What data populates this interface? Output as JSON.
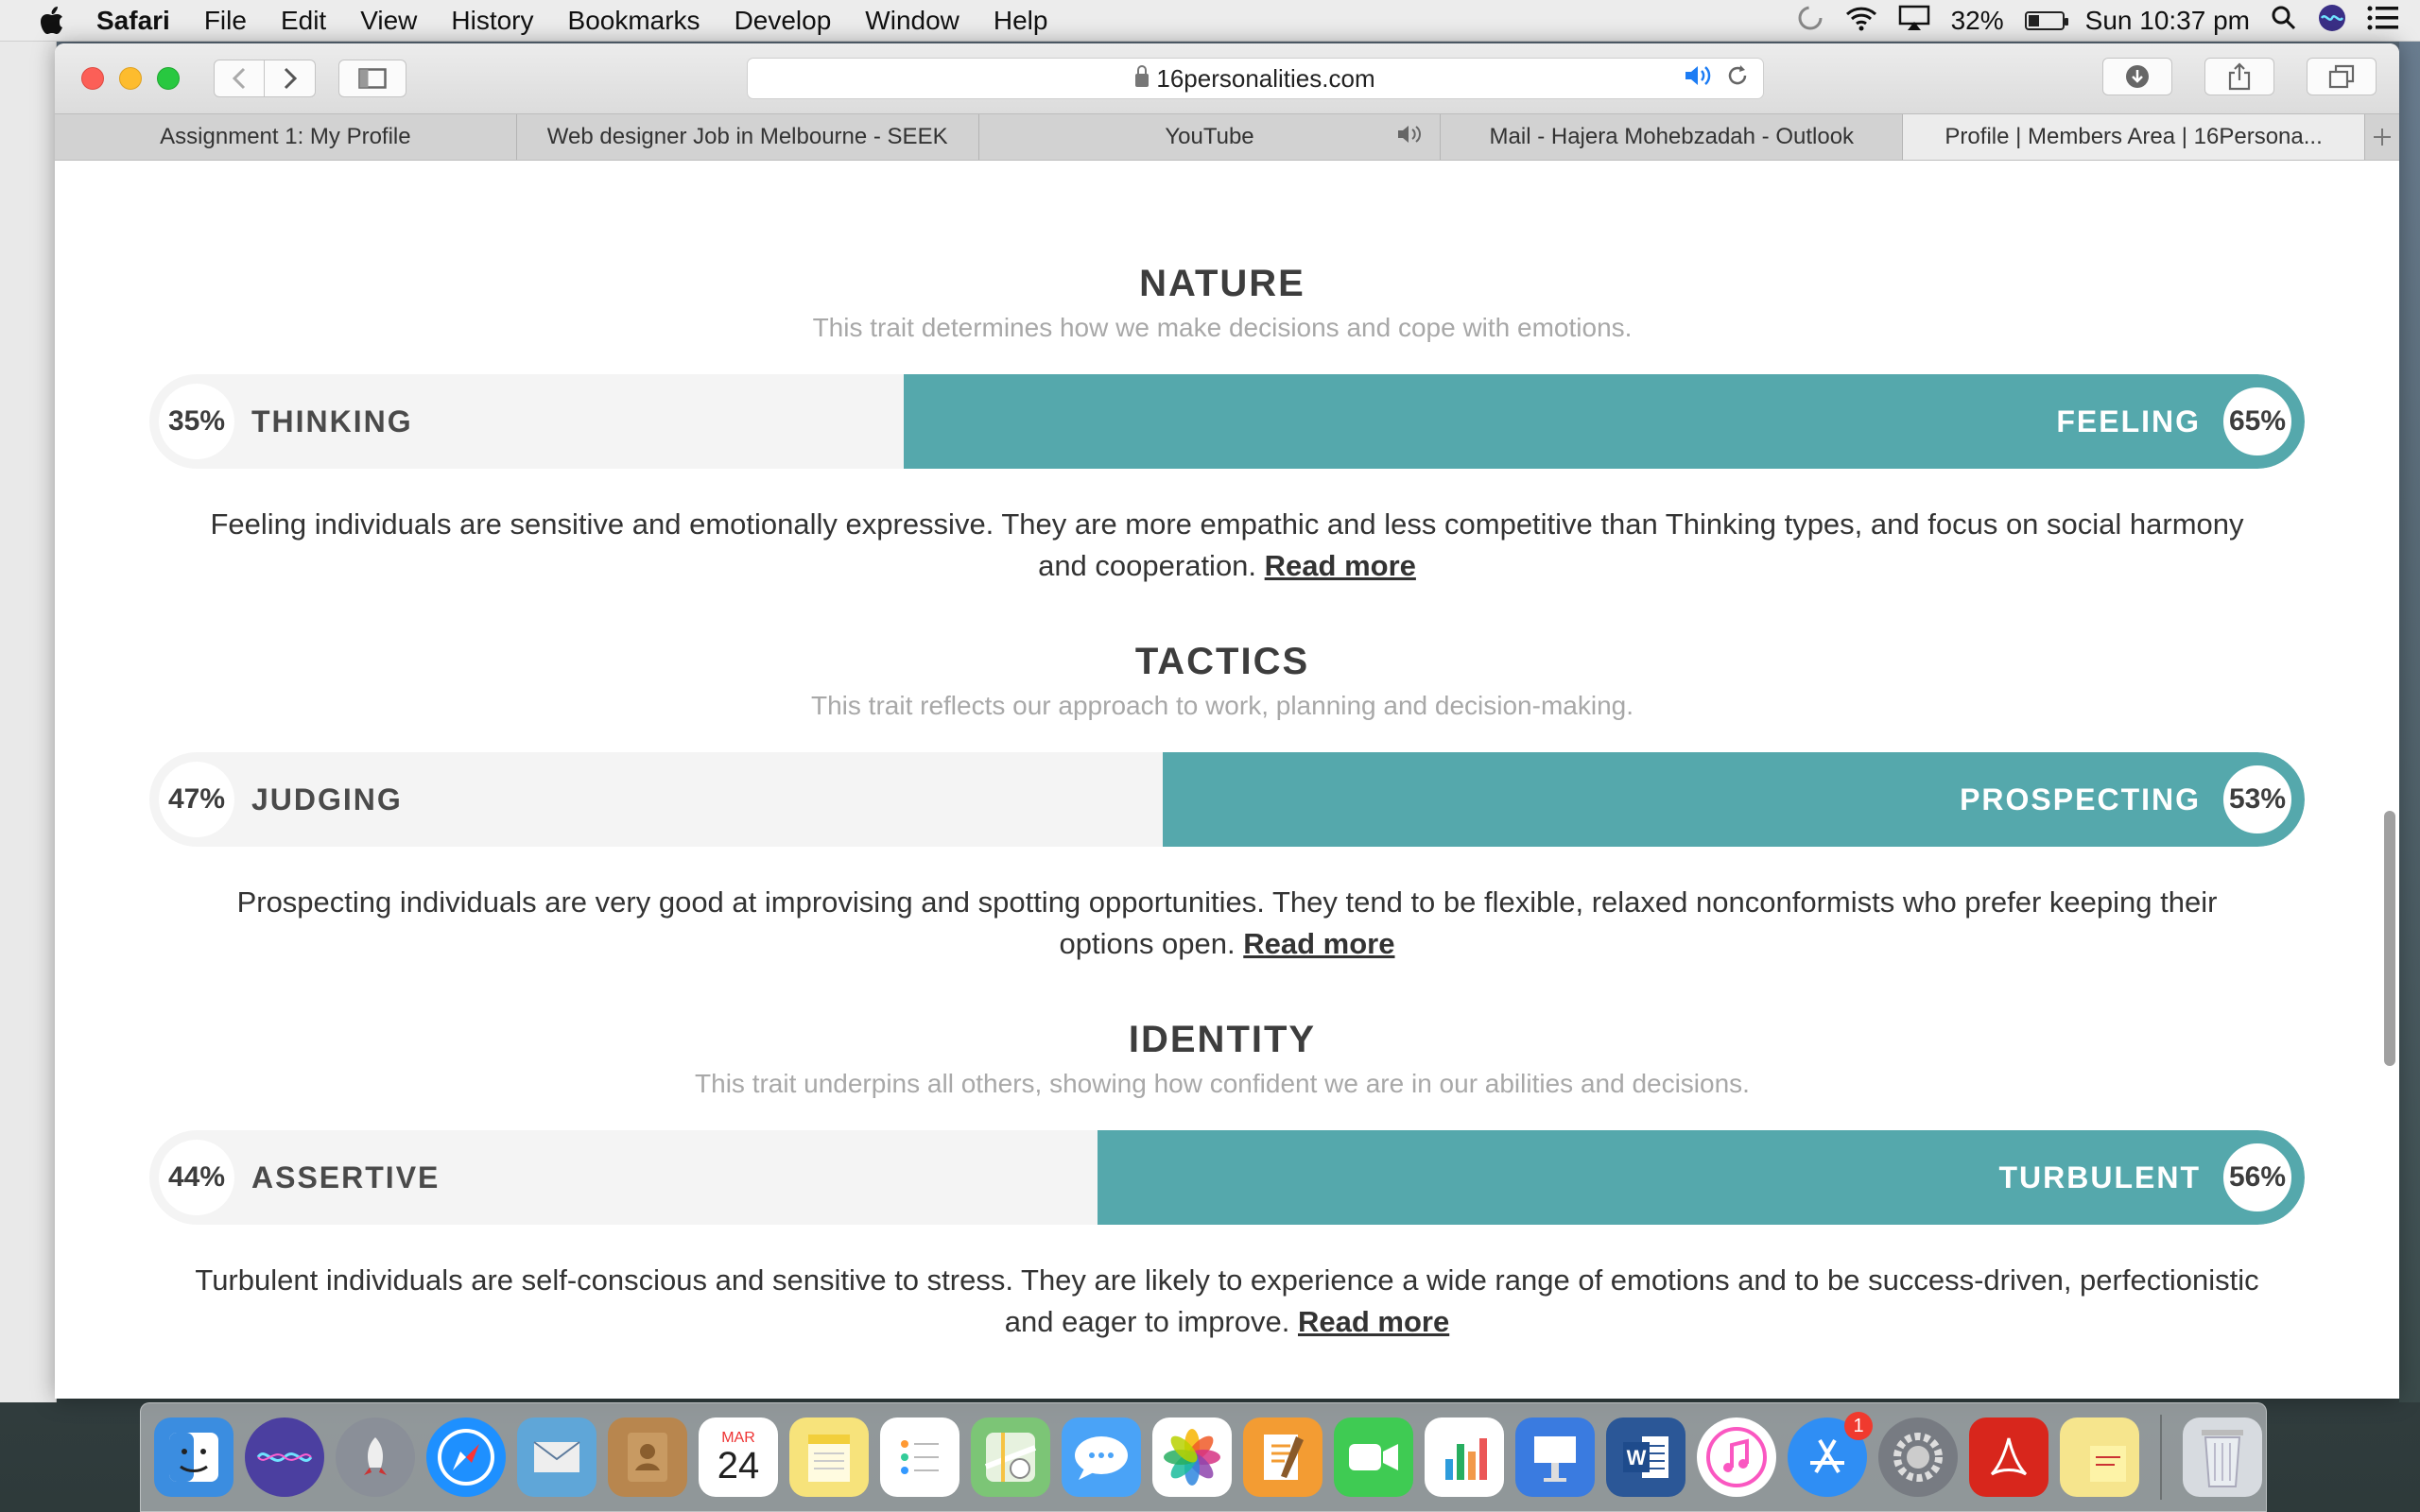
{
  "menubar": {
    "app": "Safari",
    "items": [
      "File",
      "Edit",
      "View",
      "History",
      "Bookmarks",
      "Develop",
      "Window",
      "Help"
    ],
    "battery": "32%",
    "battery_level": 0.32,
    "clock": "Sun 10:37 pm"
  },
  "browser": {
    "url": "16personalities.com",
    "tabs": [
      {
        "title": "Assignment 1: My Profile"
      },
      {
        "title": "Web designer Job in Melbourne - SEEK"
      },
      {
        "title": "YouTube"
      },
      {
        "title": "Mail - Hajera Mohebzadah - Outlook"
      },
      {
        "title": "Profile | Members Area | 16Persona..."
      }
    ]
  },
  "traits": [
    {
      "title": "NATURE",
      "subtitle": "This trait determines how we make decisions and cope with emotions.",
      "left_label": "THINKING",
      "left_pct": "35%",
      "right_label": "FEELING",
      "right_pct": "65%",
      "fill_fraction": 0.65,
      "description": "Feeling individuals are sensitive and emotionally expressive. They are more empathic and less competitive than Thinking types, and focus on social harmony and cooperation.",
      "link": "Read more"
    },
    {
      "title": "TACTICS",
      "subtitle": "This trait reflects our approach to work, planning and decision-making.",
      "left_label": "JUDGING",
      "left_pct": "47%",
      "right_label": "PROSPECTING",
      "right_pct": "53%",
      "fill_fraction": 0.53,
      "description": "Prospecting individuals are very good at improvising and spotting opportunities. They tend to be flexible, relaxed nonconformists who prefer keeping their options open.",
      "link": "Read more"
    },
    {
      "title": "IDENTITY",
      "subtitle": "This trait underpins all others, showing how confident we are in our abilities and decisions.",
      "left_label": "ASSERTIVE",
      "left_pct": "44%",
      "right_label": "TURBULENT",
      "right_pct": "56%",
      "fill_fraction": 0.56,
      "description": "Turbulent individuals are self-conscious and sensitive to stress. They are likely to experience a wide range of emotions and to be success-driven, perfectionistic and eager to improve.",
      "link": "Read more"
    }
  ],
  "dock": {
    "calendar_month": "MAR",
    "calendar_day": "24",
    "appstore_badge": "1",
    "colors": {
      "finder": "#3b8de0",
      "siri": "#4b3fa0",
      "launchpad": "#8a8f98",
      "safari": "#1e90ff",
      "mail": "#5fa6d8",
      "contacts": "#b8864e",
      "calendar": "#ffffff",
      "notes": "#f7e37b",
      "reminders": "#ffffff",
      "maps": "#7cc576",
      "messages": "#4aa3f7",
      "photos": "#ffffff",
      "pages": "#f39c33",
      "facetime": "#3fcb53",
      "numbers": "#ffffff",
      "keynote": "#3a7be0",
      "word": "#2b5797",
      "itunes": "#ffffff",
      "appstore": "#2f8ef4",
      "prefs": "#777b82",
      "acrobat": "#d8261c",
      "stickies": "#f6e58d",
      "trash": "#d7dbe0"
    }
  }
}
